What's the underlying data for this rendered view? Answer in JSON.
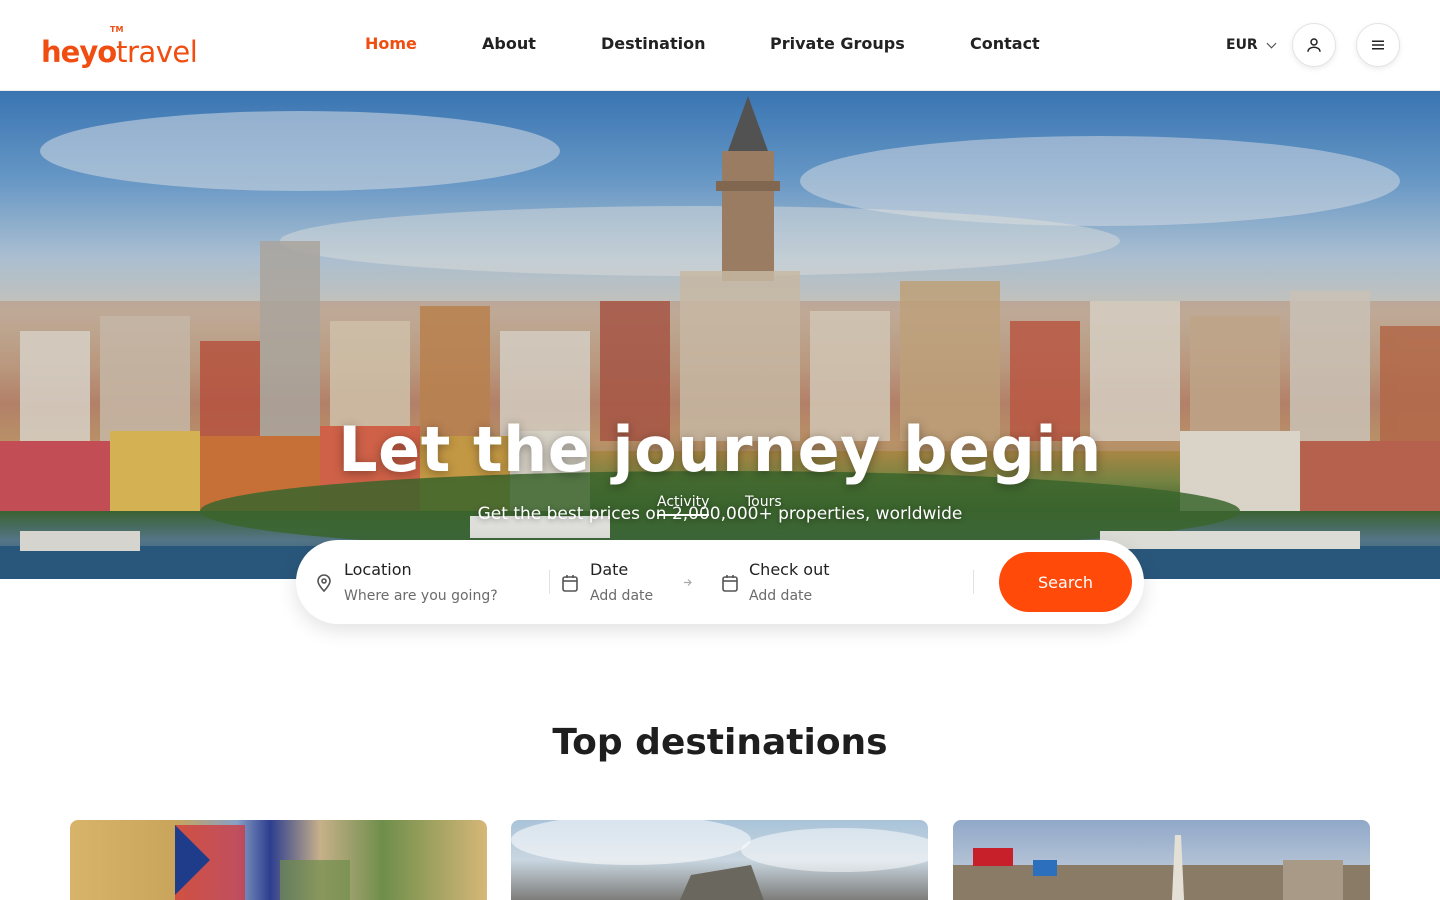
{
  "header": {
    "logo_heyo": "heyo",
    "logo_travel": "travel",
    "logo_tm": "TM",
    "nav": [
      {
        "label": "Home",
        "active": true
      },
      {
        "label": "About"
      },
      {
        "label": "Destination"
      },
      {
        "label": "Private Groups"
      },
      {
        "label": "Contact"
      }
    ],
    "currency": "EUR",
    "user_icon": "user-icon",
    "menu_icon": "menu-icon"
  },
  "hero": {
    "title": "Let the journey begin",
    "subtitle": "Get the best prices on 2,000,000+ properties, worldwide",
    "tabs": [
      {
        "label": "Activity",
        "active": true
      },
      {
        "label": "Tours"
      }
    ]
  },
  "search": {
    "location_label": "Location",
    "location_placeholder": "Where are you going?",
    "date_label": "Date",
    "date_placeholder": "Add date",
    "checkout_label": "Check out",
    "checkout_placeholder": "Add date",
    "button_label": "Search"
  },
  "section": {
    "title": "Top destinations"
  },
  "colors": {
    "brand": "#f04d10",
    "search_button": "#ff4a0a"
  }
}
